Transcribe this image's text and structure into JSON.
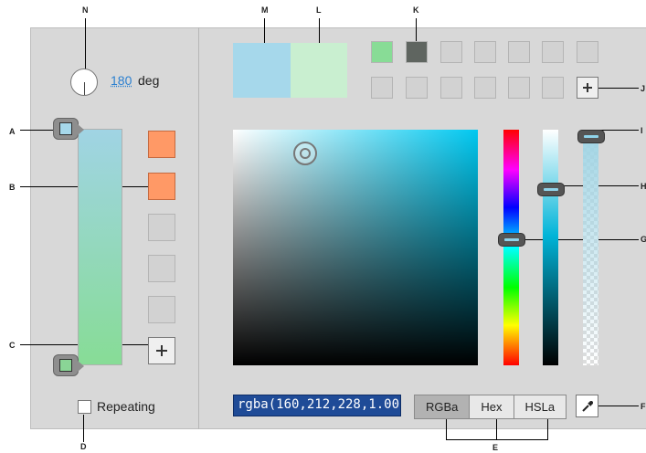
{
  "callouts": {
    "a": "A",
    "b": "B",
    "c": "C",
    "d": "D",
    "e": "E",
    "f": "F",
    "g": "G",
    "h": "H",
    "i": "I",
    "j": "J",
    "k": "K",
    "l": "L",
    "m": "M",
    "n": "N"
  },
  "gradient": {
    "angle_value": "180",
    "angle_unit": "deg",
    "stop_top_color": "#a6d8eb",
    "stop_bottom_color": "#8ad596",
    "repeating_label": "Repeating",
    "repeating_checked": false
  },
  "swatches": {
    "gradient_presets": [
      "#ff9966",
      "#ff9966",
      "#d2d2d2",
      "#d2d2d2",
      "#d2d2d2"
    ],
    "color_presets_row1": [
      "#88dc96",
      "#5f6560",
      "#d2d2d2",
      "#d2d2d2",
      "#d2d2d2",
      "#d2d2d2",
      "#d2d2d2"
    ],
    "color_presets_row2": [
      "#d2d2d2",
      "#d2d2d2",
      "#d2d2d2",
      "#d2d2d2",
      "#d2d2d2",
      "#d2d2d2"
    ]
  },
  "icons": {
    "add": "plus-icon",
    "eyedropper": "eyedropper-icon",
    "angle": "angle-dial-icon"
  },
  "picker": {
    "original_color": "#a6d8eb",
    "new_color": "#c9efd0",
    "hue_level": 0.465,
    "brightness_level": 0.24,
    "alpha_level": 1.0
  },
  "color_value": "rgba(160,212,228,1.00)",
  "modes": [
    "RGBa",
    "Hex",
    "HSLa"
  ],
  "active_mode": "RGBa"
}
